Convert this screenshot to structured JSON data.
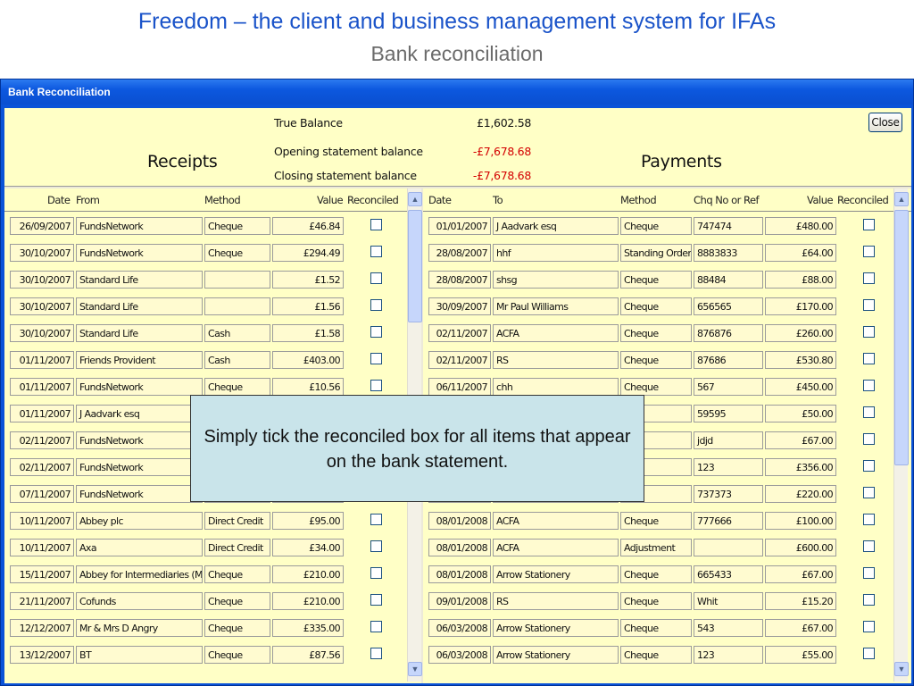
{
  "slide": {
    "title": "Freedom – the client and business management system for IFAs",
    "subtitle": "Bank reconciliation"
  },
  "window": {
    "title": "Bank Reconciliation",
    "close_label": "Close"
  },
  "summary": {
    "receipts_heading": "Receipts",
    "payments_heading": "Payments",
    "true_balance_label": "True Balance",
    "true_balance_value": "£1,602.58",
    "opening_label": "Opening statement balance",
    "opening_value": "-£7,678.68",
    "closing_label": "Closing statement balance",
    "closing_value": "-£7,678.68",
    "negative_color": "#d40000"
  },
  "receipts": {
    "columns": [
      "Date",
      "From",
      "Method",
      "Value",
      "Reconciled"
    ],
    "rows": [
      {
        "date": "26/09/2007",
        "from": "FundsNetwork",
        "method": "Cheque",
        "value": "£46.84"
      },
      {
        "date": "30/10/2007",
        "from": "FundsNetwork",
        "method": "Cheque",
        "value": "£294.49"
      },
      {
        "date": "30/10/2007",
        "from": "Standard Life",
        "method": "",
        "value": "£1.52"
      },
      {
        "date": "30/10/2007",
        "from": "Standard Life",
        "method": "",
        "value": "£1.56"
      },
      {
        "date": "30/10/2007",
        "from": "Standard Life",
        "method": "Cash",
        "value": "£1.58"
      },
      {
        "date": "01/11/2007",
        "from": "Friends Provident",
        "method": "Cash",
        "value": "£403.00"
      },
      {
        "date": "01/11/2007",
        "from": "FundsNetwork",
        "method": "Cheque",
        "value": "£10.56"
      },
      {
        "date": "01/11/2007",
        "from": "J Aadvark esq",
        "method": "",
        "value": ""
      },
      {
        "date": "02/11/2007",
        "from": "FundsNetwork",
        "method": "",
        "value": ""
      },
      {
        "date": "02/11/2007",
        "from": "FundsNetwork",
        "method": "",
        "value": ""
      },
      {
        "date": "07/11/2007",
        "from": "FundsNetwork",
        "method": "",
        "value": ""
      },
      {
        "date": "10/11/2007",
        "from": "Abbey plc",
        "method": "Direct Credit",
        "value": "£95.00"
      },
      {
        "date": "10/11/2007",
        "from": "Axa",
        "method": "Direct Credit",
        "value": "£34.00"
      },
      {
        "date": "15/11/2007",
        "from": "Abbey for Intermediaries (Mt",
        "method": "Cheque",
        "value": "£210.00"
      },
      {
        "date": "21/11/2007",
        "from": "Cofunds",
        "method": "Cheque",
        "value": "£210.00"
      },
      {
        "date": "12/12/2007",
        "from": "Mr & Mrs D Angry",
        "method": "Cheque",
        "value": "£335.00"
      },
      {
        "date": "13/12/2007",
        "from": "BT",
        "method": "Cheque",
        "value": "£87.56"
      }
    ]
  },
  "payments": {
    "columns": [
      "Date",
      "To",
      "Method",
      "Chq No or Ref",
      "Value",
      "Reconciled"
    ],
    "rows": [
      {
        "date": "01/01/2007",
        "to": "J Aadvark esq",
        "method": "Cheque",
        "ref": "747474",
        "value": "£480.00"
      },
      {
        "date": "28/08/2007",
        "to": "hhf",
        "method": "Standing Order",
        "ref": "8883833",
        "value": "£64.00"
      },
      {
        "date": "28/08/2007",
        "to": "shsg",
        "method": "Cheque",
        "ref": "88484",
        "value": "£88.00"
      },
      {
        "date": "30/09/2007",
        "to": "Mr Paul Williams",
        "method": "Cheque",
        "ref": "656565",
        "value": "£170.00"
      },
      {
        "date": "02/11/2007",
        "to": "ACFA",
        "method": "Cheque",
        "ref": "876876",
        "value": "£260.00"
      },
      {
        "date": "02/11/2007",
        "to": "RS",
        "method": "Cheque",
        "ref": "87686",
        "value": "£530.80"
      },
      {
        "date": "06/11/2007",
        "to": "chh",
        "method": "Cheque",
        "ref": "567",
        "value": "£450.00"
      },
      {
        "date": "",
        "to": "",
        "method": "ue",
        "ref": "59595",
        "value": "£50.00"
      },
      {
        "date": "",
        "to": "",
        "method": "",
        "ref": "jdjd",
        "value": "£67.00"
      },
      {
        "date": "",
        "to": "",
        "method": "ue",
        "ref": "123",
        "value": "£356.00"
      },
      {
        "date": "",
        "to": "",
        "method": "ue",
        "ref": "737373",
        "value": "£220.00"
      },
      {
        "date": "08/01/2008",
        "to": "ACFA",
        "method": "Cheque",
        "ref": "777666",
        "value": "£100.00"
      },
      {
        "date": "08/01/2008",
        "to": "ACFA",
        "method": "Adjustment",
        "ref": "",
        "value": "£600.00"
      },
      {
        "date": "08/01/2008",
        "to": "Arrow Stationery",
        "method": "Cheque",
        "ref": "665433",
        "value": "£67.00"
      },
      {
        "date": "09/01/2008",
        "to": "RS",
        "method": "Cheque",
        "ref": "Whit",
        "value": "£15.20"
      },
      {
        "date": "06/03/2008",
        "to": "Arrow Stationery",
        "method": "Cheque",
        "ref": "543",
        "value": "£67.00"
      },
      {
        "date": "06/03/2008",
        "to": "Arrow Stationery",
        "method": "Cheque",
        "ref": "123",
        "value": "£55.00"
      }
    ]
  },
  "callout": {
    "text": "Simply tick the reconciled box for all items that appear on the bank statement."
  },
  "icons": {
    "scroll_up": "scroll-up-arrow-icon",
    "scroll_down": "scroll-down-arrow-icon"
  }
}
